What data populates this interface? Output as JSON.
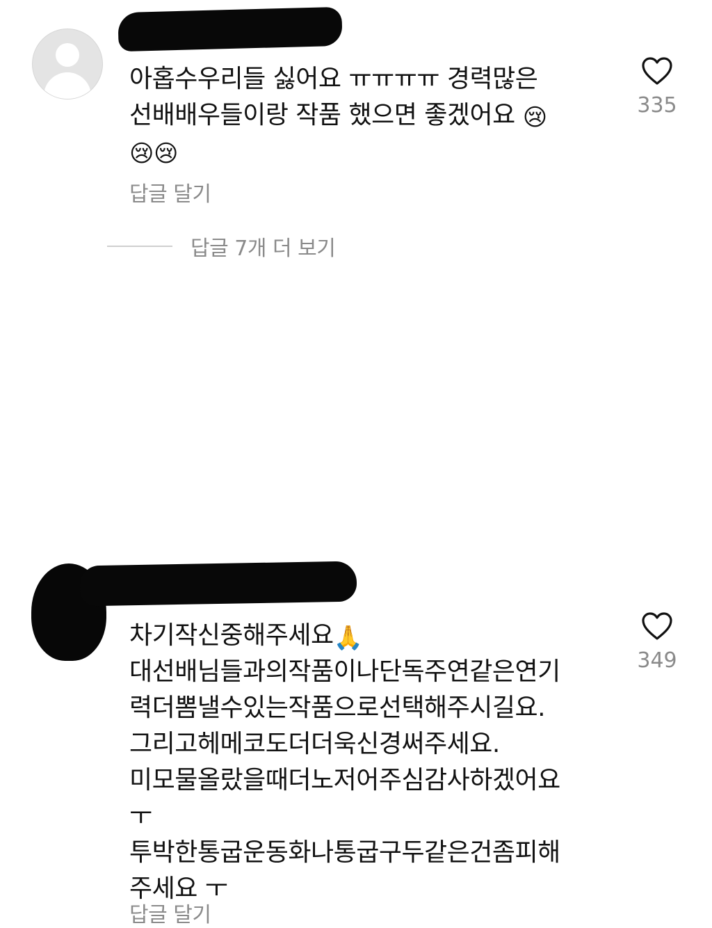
{
  "comments": [
    {
      "lines": [
        "아홉수우리들 싫어요 ㅠㅠㅠㅠ 경력많은",
        "선배배우들이랑 작품 했으면 좋겠어요"
      ],
      "emojis": [
        "😢",
        "😢",
        "😢"
      ],
      "likes": "335",
      "reply_label": "답글 달기"
    },
    {
      "first_line": "차기작신중해주세요",
      "first_emoji": "🙏",
      "lines": [
        "대선배님들과의작품이나단독주연같은연기",
        "력더뽐낼수있는작품으로선택해주시길요.",
        "그리고헤메코도더더욱신경써주세요.",
        "미모물올랐을때더노저어주심감사하겠어요",
        "ㅜ",
        "투박한통굽운동화나통굽구두같은건좀피해",
        "주세요 ㅜ"
      ],
      "likes": "349",
      "reply_label": "답글 달기"
    }
  ],
  "more_replies_label": "답글 7개 더 보기",
  "icons": {
    "like": "heart-outline-icon",
    "avatar": "default-profile-icon"
  },
  "colors": {
    "text": "#111111",
    "secondary_text": "#8a8a8a",
    "divider": "#cfcfcf",
    "avatar_default": "#e4e4e4",
    "redaction": "#080808"
  }
}
